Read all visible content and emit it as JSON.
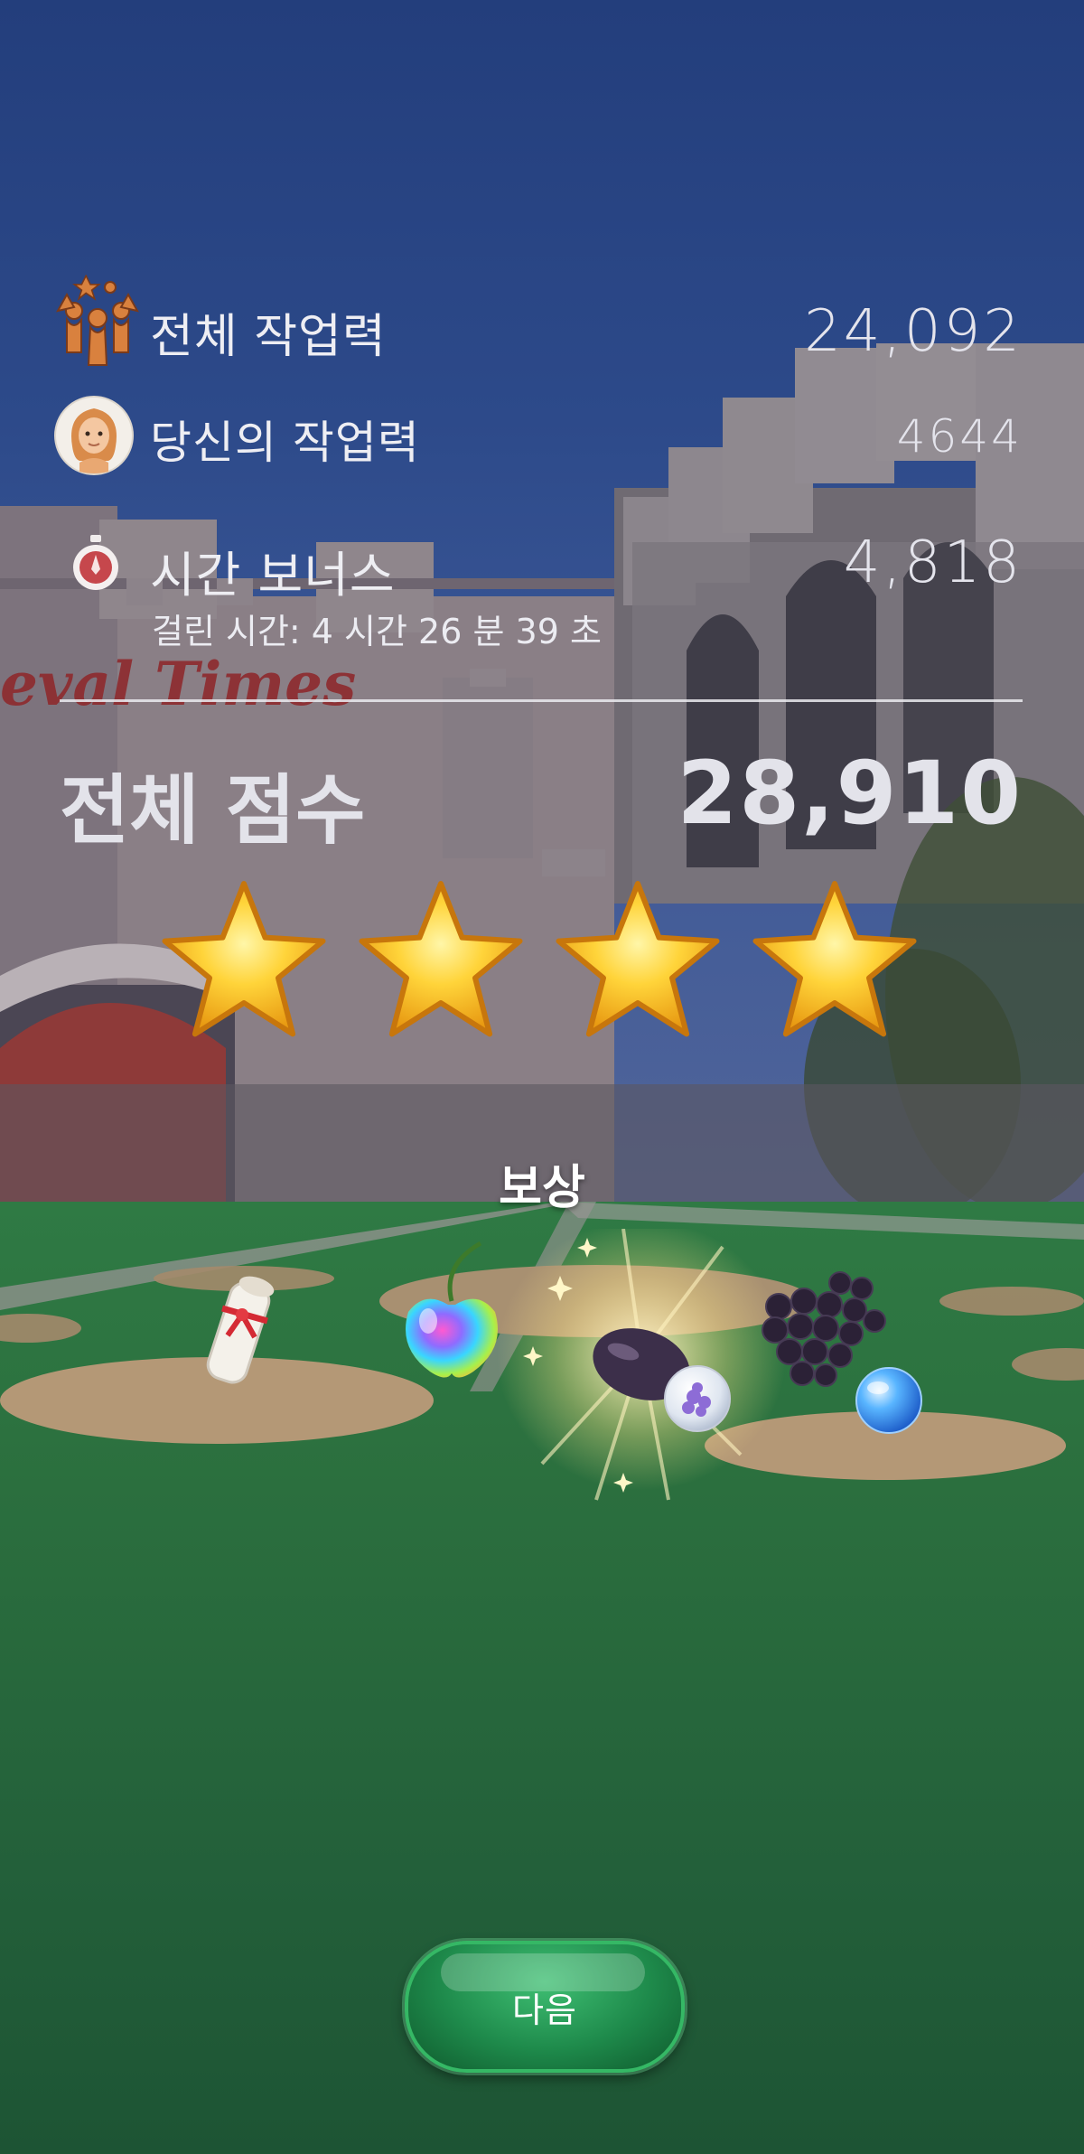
{
  "scoreboard": {
    "total_workforce_label": "전체 작업력",
    "total_workforce_value": "24,092",
    "your_workforce_label": "당신의 작업력",
    "your_workforce_value": "4644",
    "time_bonus_label": "시간 보너스",
    "time_bonus_value": "4,818",
    "time_taken_label": "걸린 시간: 4 시간 26 분 39 초",
    "total_score_label": "전체 점수",
    "total_score_value": "28,910",
    "stars_earned": 4
  },
  "rewards": {
    "title": "보상",
    "items": [
      "scroll-icon",
      "rainbow-cherry-icon",
      "plum-icon",
      "grapes-icon"
    ]
  },
  "next_button_label": "다음",
  "colors": {
    "sky": "#2d4a8a",
    "grass": "#2b6f3e",
    "star": "#f6c02a",
    "button": "#1e8a4b"
  }
}
